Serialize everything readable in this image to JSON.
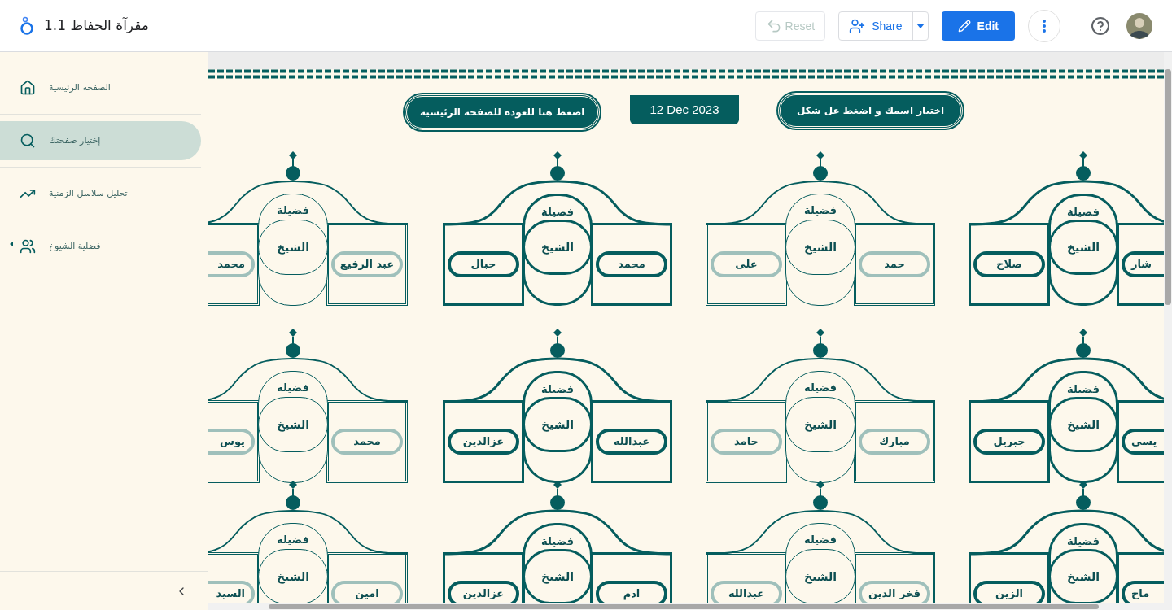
{
  "header": {
    "title": "مقرآة الحفاظ 1.1",
    "reset_button": {
      "label": "Reset",
      "disabled": true
    },
    "share_button": {
      "label": "Share",
      "disabled": false
    },
    "edit_button": {
      "label": "Edit",
      "disabled": false
    }
  },
  "sidebar": {
    "items": [
      {
        "kind": "home",
        "label": "الصفحه الرئيسية",
        "selected": false
      },
      {
        "kind": "search",
        "label": "إختيار صفحتك",
        "selected": true
      },
      {
        "kind": "trend",
        "label": "تحليل سلاسل الزمنية",
        "selected": false
      },
      {
        "kind": "group",
        "label": "فضلية الشيوخ",
        "selected": false,
        "expanded": false
      }
    ]
  },
  "canvas": {
    "back_button": "اضغط هنا للعوده للصفحة الرئيسية",
    "date": "12 Dec 2023",
    "instruction_button": "اختيار اسمك و اضغط عل شكل",
    "rows": [
      [
        {
          "kind": "bold",
          "title": "فضيلة",
          "subtitle": "الشيخ",
          "right_name": "شار",
          "left_name": "صلاح"
        },
        {
          "kind": "thin",
          "title": "فضيلة",
          "subtitle": "الشيخ",
          "right_name": "حمد",
          "left_name": "على"
        },
        {
          "kind": "bold",
          "title": "فضيلة",
          "subtitle": "الشيخ",
          "right_name": "محمد",
          "left_name": "جبال"
        },
        {
          "kind": "thin",
          "title": "فضيلة",
          "subtitle": "الشيخ",
          "right_name": "عبد الرفيع",
          "left_name": "محمد"
        }
      ],
      [
        {
          "kind": "bold",
          "title": "فضيلة",
          "subtitle": "الشيخ",
          "right_name": "يسى",
          "left_name": "جبريل"
        },
        {
          "kind": "thin",
          "title": "فضيلة",
          "subtitle": "الشيخ",
          "right_name": "مبارك",
          "left_name": "حامد"
        },
        {
          "kind": "bold",
          "title": "فضيلة",
          "subtitle": "الشيخ",
          "right_name": "عبدالله",
          "left_name": "عزالدين"
        },
        {
          "kind": "thin",
          "title": "فضيلة",
          "subtitle": "الشيخ",
          "right_name": "محمد",
          "left_name": "يوس"
        }
      ],
      [
        {
          "kind": "bold",
          "title": "فضيلة",
          "subtitle": "الشيخ",
          "right_name": "ماح",
          "left_name": "الزين"
        },
        {
          "kind": "thin",
          "title": "فضيلة",
          "subtitle": "الشيخ",
          "right_name": "فخر الدين",
          "left_name": "عبدالله"
        },
        {
          "kind": "bold",
          "title": "فضيلة",
          "subtitle": "الشيخ",
          "right_name": "ادم",
          "left_name": "عزالدين"
        },
        {
          "kind": "thin",
          "title": "فضيلة",
          "subtitle": "الشيخ",
          "right_name": "امين",
          "left_name": "السيد"
        }
      ]
    ]
  }
}
